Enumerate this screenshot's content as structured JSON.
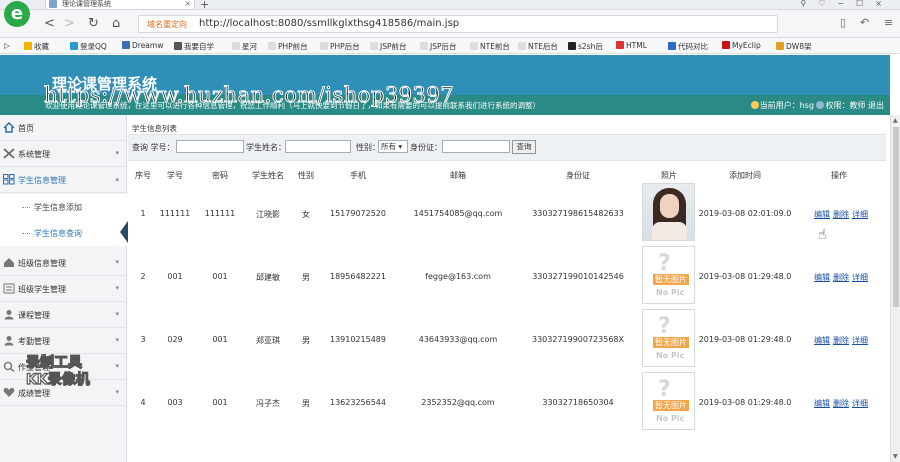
{
  "browser": {
    "tab_title": "理论课管理系统",
    "url_badge": "域名重定向",
    "url": "http://localhost:8080/ssmllkglxthsg418586/main.jsp",
    "bookmarks": [
      "收藏",
      "登录QQ",
      "Dreamw",
      "我要自学",
      "星河",
      "PHP前台",
      "PHP后台",
      "JSP前台",
      "JSP后台",
      "NTE前台",
      "NTE后台",
      "s2sh后",
      "HTML",
      "代码对比",
      "MyEclip",
      "DW8架"
    ]
  },
  "app": {
    "title": "理论课管理系统",
    "marquee": "欢迎使用理论课管理系统，在这里可以进行各种信息管理，祝您工作顺利（马上就快要到节假日了，如果有需要的可以提前联系我们进行系统的调整）",
    "user_label": "当前用户：hsg",
    "role_label": "权限：教师",
    "logout": "退出"
  },
  "watermark": "https://www.huzhan.com/ishop39397",
  "recorder_overlay": [
    "录制工具",
    "KK录像机"
  ],
  "sidebar": {
    "items": [
      {
        "label": "首页",
        "icon": "home-icon"
      },
      {
        "label": "系统管理",
        "icon": "tools-icon"
      },
      {
        "label": "学生信息管理",
        "icon": "grid-icon"
      },
      {
        "label": "班级信息管理",
        "icon": "house-icon"
      },
      {
        "label": "班级学生管理",
        "icon": "list-icon"
      },
      {
        "label": "课程管理",
        "icon": "user-icon"
      },
      {
        "label": "考勤管理",
        "icon": "user-icon"
      },
      {
        "label": "作业管理",
        "icon": "search-icon"
      },
      {
        "label": "成绩管理",
        "icon": "heart-icon"
      }
    ],
    "subitems": [
      "学生信息添加",
      "学生信息查询"
    ]
  },
  "content": {
    "breadcrumb": "学生信息列表",
    "search": {
      "query_label": "查询 学号：",
      "name_label": "学生姓名：",
      "gender_label": "性别：",
      "gender_value": "所有",
      "idcard_label": "身份证：",
      "button": "查询"
    },
    "columns": [
      "序号",
      "学号",
      "密码",
      "学生姓名",
      "性别",
      "手机",
      "邮箱",
      "身份证",
      "照片",
      "添加时间",
      "操作"
    ],
    "rows": [
      {
        "no": "1",
        "sid": "111111",
        "pwd": "111111",
        "name": "江晓影",
        "gender": "女",
        "phone": "15179072520",
        "email": "1451754085@qq.com",
        "idcard": "330327198615482633",
        "photo": "person",
        "time": "2019-03-08 02:01:09.0"
      },
      {
        "no": "2",
        "sid": "001",
        "pwd": "001",
        "name": "邱建敏",
        "gender": "男",
        "phone": "18956482221",
        "email": "fegge@163.com",
        "idcard": "330327199010142546",
        "photo": "none",
        "time": "2019-03-08 01:29:48.0"
      },
      {
        "no": "3",
        "sid": "029",
        "pwd": "001",
        "name": "郑亚琪",
        "gender": "男",
        "phone": "13910215489",
        "email": "43643933@qq.com",
        "idcard": "33032719900723568X",
        "photo": "none",
        "time": "2019-03-08 01:29:48.0"
      },
      {
        "no": "4",
        "sid": "003",
        "pwd": "001",
        "name": "冯子杰",
        "gender": "男",
        "phone": "13623256544",
        "email": "2352352@qq.com",
        "idcard": "33032718650304",
        "photo": "none",
        "time": "2019-03-08 01:29:48.0"
      }
    ],
    "actions": [
      "编辑",
      "删除",
      "详细"
    ],
    "nopic_label": "暂无图片",
    "nopic_sub": "No Pic"
  }
}
